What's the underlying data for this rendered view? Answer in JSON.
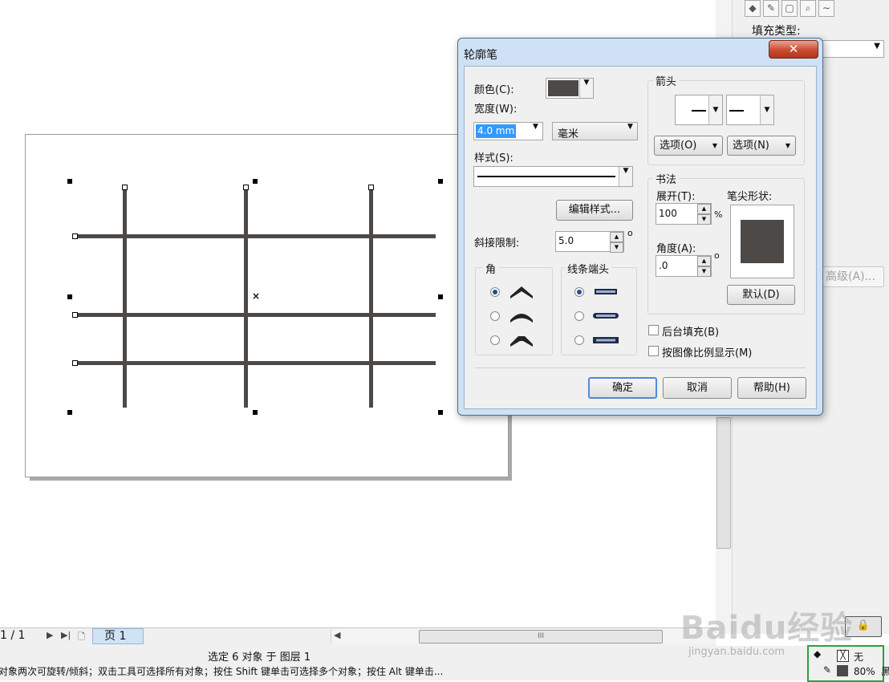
{
  "app": {
    "page_nav": {
      "page_count": "1 / 1",
      "page_tab": "页 1"
    },
    "docker": {
      "fill_type_label": "填充类型:",
      "advanced_button": "高级(A)...",
      "tab_icons": [
        "fill-bucket-icon",
        "pen-icon",
        "rectangle-icon",
        "zoom-icon",
        "curve-icon"
      ]
    },
    "status": {
      "selection": "选定 6 对象 于 图层 1",
      "hint": "对象两次可旋转/倾斜；双击工具可选择所有对象；按住 Shift 键单击可选择多个对象；按住 Alt 键单击...",
      "fill_value": "无",
      "outline_value": "80%",
      "trailing_char": "黑"
    },
    "watermark": {
      "main": "Baidu经验",
      "sub": "jingyan.baidu.com"
    }
  },
  "dialog": {
    "title": "轮廓笔",
    "color_label": "颜色(C):",
    "color_value": "#4d4946",
    "width_label": "宽度(W):",
    "width_value": "4.0 mm",
    "unit_value": "毫米",
    "style_label": "样式(S):",
    "edit_style_button": "编辑样式...",
    "miter_label": "斜接限制:",
    "miter_value": "5.0",
    "degree_symbol": "o",
    "corners_label": "角",
    "line_caps_label": "线条端头",
    "arrows_label": "箭头",
    "arrow_options_left": "选项(O)",
    "arrow_options_right": "选项(N)",
    "calligraphy_label": "书法",
    "stretch_label": "展开(T):",
    "stretch_value": "100",
    "percent_symbol": "%",
    "nib_shape_label": "笔尖形状:",
    "angle_label": "角度(A):",
    "angle_value": ".0",
    "default_button": "默认(D)",
    "behind_fill_label": "后台填充(B)",
    "scale_with_image_label": "按图像比例显示(M)",
    "ok_button": "确定",
    "cancel_button": "取消",
    "help_button": "帮助(H)",
    "corner_selected": 0,
    "cap_selected": 0
  }
}
